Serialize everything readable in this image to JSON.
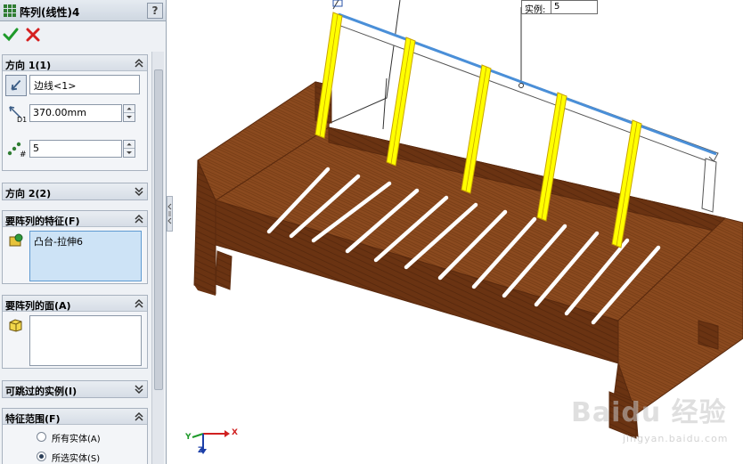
{
  "feature": {
    "title": "阵列(线性)4",
    "help_label": "?"
  },
  "actions": {
    "ok_icon": "check-icon",
    "cancel_icon": "x-icon"
  },
  "direction1": {
    "header": "方向 1(1)",
    "edge_value": "边线<1>",
    "spacing_value": "370.00mm",
    "count_value": "5",
    "spacing_badge": "D1",
    "count_badge": "#"
  },
  "direction2": {
    "header": "方向 2(2)"
  },
  "features_to_pattern": {
    "header": "要阵列的特征(F)",
    "items": [
      "凸台-拉伸6"
    ]
  },
  "faces_to_pattern": {
    "header": "要阵列的面(A)"
  },
  "instances_to_skip": {
    "header": "可跳过的实例(I)"
  },
  "feature_scope": {
    "header": "特征范围(F)",
    "options": [
      {
        "label": "所有实体(A)",
        "selected": false
      },
      {
        "label": "所选实体(S)",
        "selected": true
      }
    ]
  },
  "viewport": {
    "instance_label": "实例:",
    "instance_value": "5",
    "triad": {
      "x": "X",
      "y": "Y",
      "z": "Z"
    }
  },
  "watermark": {
    "line1": "Baidu 经验",
    "line2": "jingyan.baidu.com"
  },
  "colors": {
    "wood": "#8b4a1f",
    "wood_dark": "#6a3312",
    "highlight": "#ffff00",
    "edge_blue": "#4a8fd8",
    "panel_bg": "#eef1f5"
  }
}
